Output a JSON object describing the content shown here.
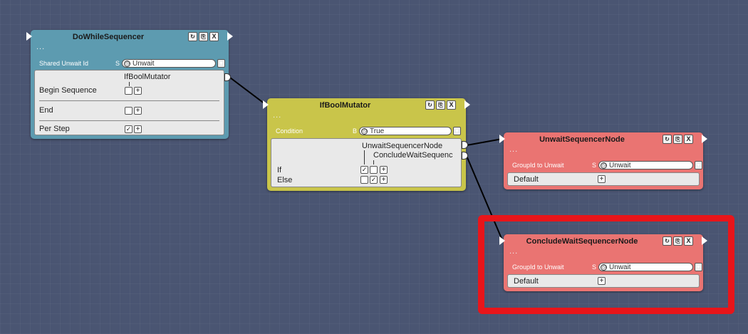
{
  "icons": {
    "refresh": "↻",
    "copy": "⎘",
    "close": "X",
    "dropdown": "▼",
    "clock": "◷",
    "check": "✓",
    "plus": "+",
    "dots": "..."
  },
  "nodes": {
    "dowhile": {
      "title": "DoWhileSequencer",
      "prop": {
        "label": "Shared Unwait Id",
        "type": "S",
        "value": "Unwait"
      },
      "connected_label": "IfBoolMutator",
      "rows": [
        {
          "label": "Begin Sequence",
          "checked": false
        },
        {
          "label": "End",
          "checked": false
        },
        {
          "label": "Per Step",
          "checked": true
        }
      ]
    },
    "ifbool": {
      "title": "IfBoolMutator",
      "prop": {
        "label": "Condition",
        "type": "B",
        "value": "True"
      },
      "connected_labels": [
        "UnwaitSequencerNode",
        "ConcludeWaitSequenc"
      ],
      "rows": [
        {
          "label": "If",
          "checks": [
            true,
            false
          ]
        },
        {
          "label": "Else",
          "checks": [
            false,
            true
          ]
        }
      ]
    },
    "unwait": {
      "title": "UnwaitSequencerNode",
      "prop": {
        "label": "GroupId to Unwait",
        "type": "S",
        "value": "Unwait"
      },
      "default_label": "Default"
    },
    "conclude": {
      "title": "ConcludeWaitSequencerNode",
      "prop": {
        "label": "GroupId to Unwait",
        "type": "S",
        "value": "Unwait"
      },
      "default_label": "Default"
    }
  },
  "colors": {
    "blue_node": "#5d9bb0",
    "yellow_node": "#c9c54a",
    "red_node": "#ea7472",
    "highlight": "#e8151a",
    "canvas": "#4a5572"
  }
}
